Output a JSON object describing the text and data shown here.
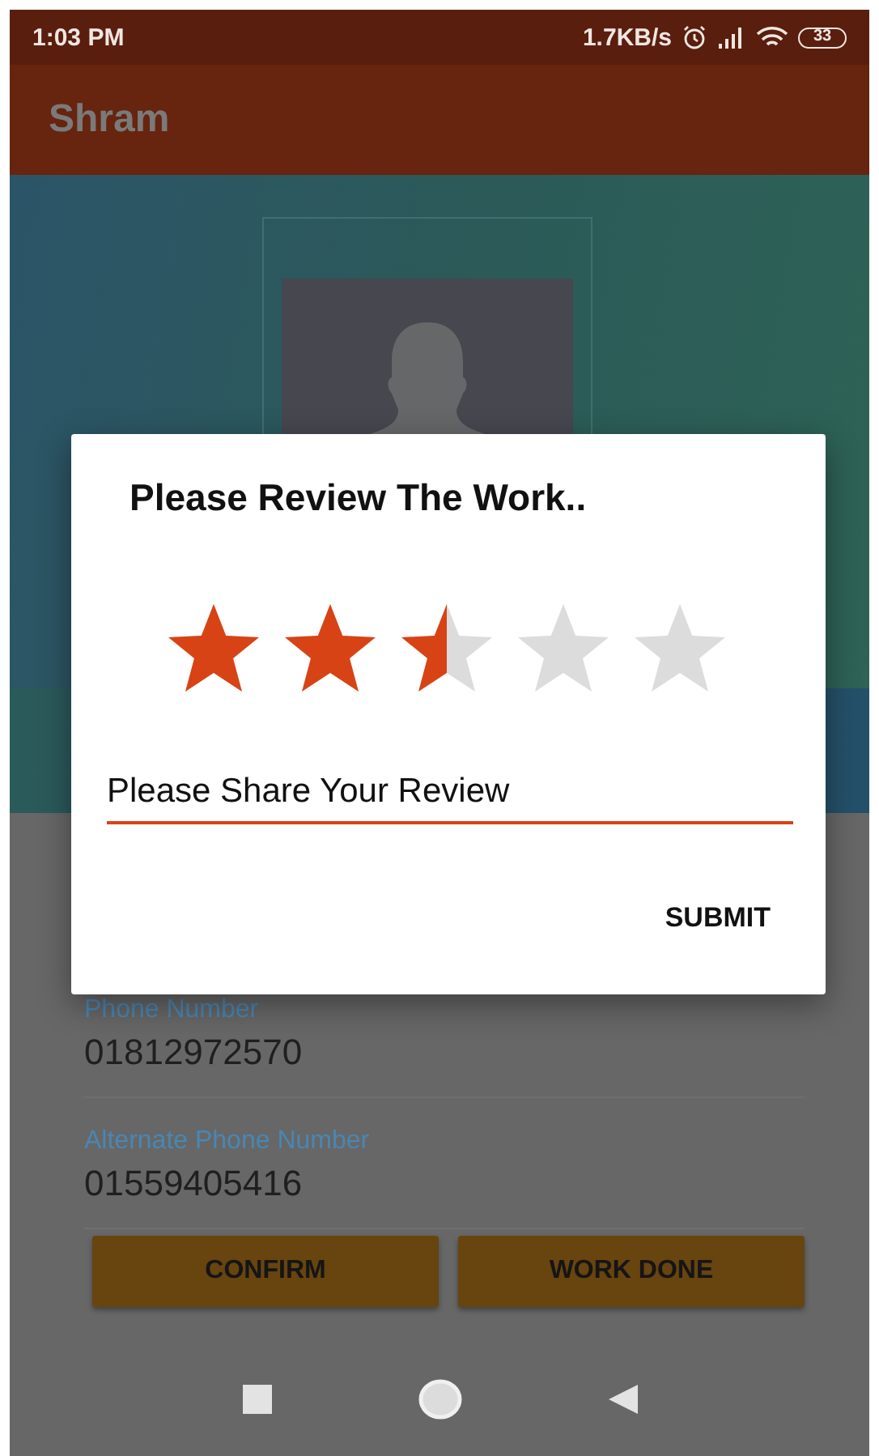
{
  "status_bar": {
    "time": "1:03 PM",
    "speed": "1.7KB/s",
    "battery": "33"
  },
  "app_bar": {
    "title": "Shram"
  },
  "profile": {
    "kind": "avatar"
  },
  "contact": [
    {
      "label": "Phone Number",
      "value": "01812972570"
    },
    {
      "label": "Alternate Phone Number",
      "value": "01559405416"
    }
  ],
  "buttons": [
    "CONFIRM",
    "WORK DONE"
  ],
  "dialog": {
    "title": "Please Review The Work..",
    "stars": 2.5,
    "review": {
      "value": "Please Share Your Review"
    },
    "action": "SUBMIT"
  }
}
